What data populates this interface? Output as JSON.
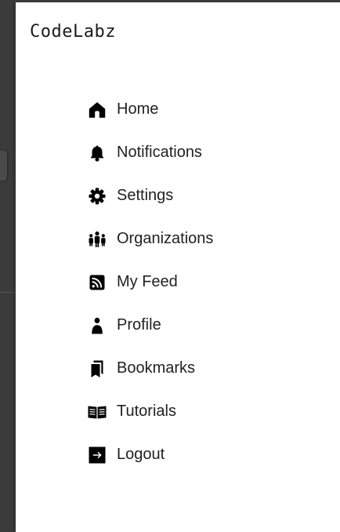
{
  "app": {
    "logo_text": "CodeLabz"
  },
  "nav": {
    "items": [
      {
        "label": "Home",
        "icon": "home-icon"
      },
      {
        "label": "Notifications",
        "icon": "bell-icon"
      },
      {
        "label": "Settings",
        "icon": "gear-icon"
      },
      {
        "label": "Organizations",
        "icon": "people-group-icon"
      },
      {
        "label": "My Feed",
        "icon": "rss-feed-icon"
      },
      {
        "label": "Profile",
        "icon": "person-icon"
      },
      {
        "label": "Bookmarks",
        "icon": "bookmarks-icon"
      },
      {
        "label": "Tutorials",
        "icon": "open-book-icon"
      },
      {
        "label": "Logout",
        "icon": "logout-icon"
      }
    ]
  },
  "colors": {
    "drawer_background": "#ffffff",
    "backdrop": "#3b3b3b",
    "text": "#222222",
    "icon": "#000000"
  }
}
